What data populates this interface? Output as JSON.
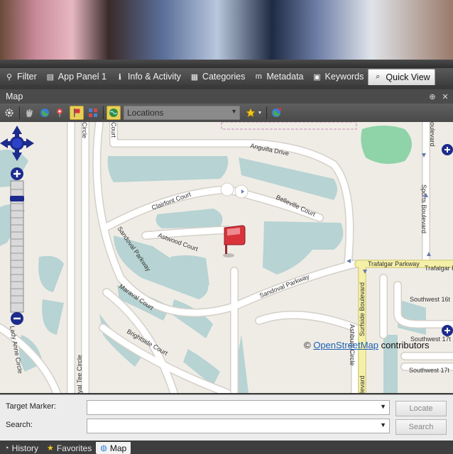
{
  "top_tabs": [
    {
      "label": "Filter",
      "icon": "funnel-icon",
      "glyph": "⚲"
    },
    {
      "label": "App Panel 1",
      "icon": "app-panel-icon",
      "glyph": "▤"
    },
    {
      "label": "Info & Activity",
      "icon": "info-icon",
      "glyph": "ℹ"
    },
    {
      "label": "Categories",
      "icon": "categories-icon",
      "glyph": "▦"
    },
    {
      "label": "Metadata",
      "icon": "metadata-icon",
      "glyph": "m"
    },
    {
      "label": "Keywords",
      "icon": "keywords-icon",
      "glyph": "▣"
    },
    {
      "label": "Quick View",
      "icon": "magnifier-icon",
      "glyph": "⌕"
    }
  ],
  "panel": {
    "title": "Map",
    "pin_glyph": "⊕",
    "close_glyph": "✕"
  },
  "toolbar": {
    "locations_placeholder": "Locations"
  },
  "map": {
    "streets": {
      "anguilla": "Anguilla Drive",
      "clairfont": "Clairfont Court",
      "belleville": "Belleville Court",
      "astwood": "Astwood Court",
      "sandoval_pkwy_left": "Sandoval Parkway",
      "sandoval_pkwy_right": "Sandoval Parkway",
      "maraval": "Maraval Court",
      "brightside": "Brightside Court",
      "trafalgar1": "Trafalgar Parkway",
      "trafalgar2": "Trafalgar Par",
      "sports": "Sports Boulevard",
      "surfside": "Surfside Boulevard",
      "ashbury": "Ashbury Circle",
      "southwest16": "Southwest 16t",
      "southwest17a": "Southwest 17t",
      "southwest17b": "Southwest 17t",
      "lady_anne": "Lady Anne Circle",
      "royal_tee": "yal Tee Circle",
      "circle_top": "Circle",
      "court_top": "Court",
      "boulevard_top": "oulevard",
      "boulevard_bottom": "levard"
    },
    "attribution": {
      "prefix": "© ",
      "link": "OpenStreetMap",
      "suffix": " contributors"
    },
    "colors": {
      "water": "#b7d3d3",
      "park": "#8fd3a8",
      "road": "#ffffff",
      "major_road": "#f5f0a8",
      "marker": "#d9343c"
    }
  },
  "form": {
    "target_marker_label": "Target Marker:",
    "search_label": "Search:",
    "locate_button": "Locate",
    "search_button": "Search"
  },
  "bottom_tabs": [
    {
      "label": "History",
      "icon": "history-icon",
      "glyph": "◔"
    },
    {
      "label": "Favorites",
      "icon": "star-icon",
      "glyph": "★"
    },
    {
      "label": "Map",
      "icon": "globe-icon",
      "glyph": "◍"
    }
  ]
}
